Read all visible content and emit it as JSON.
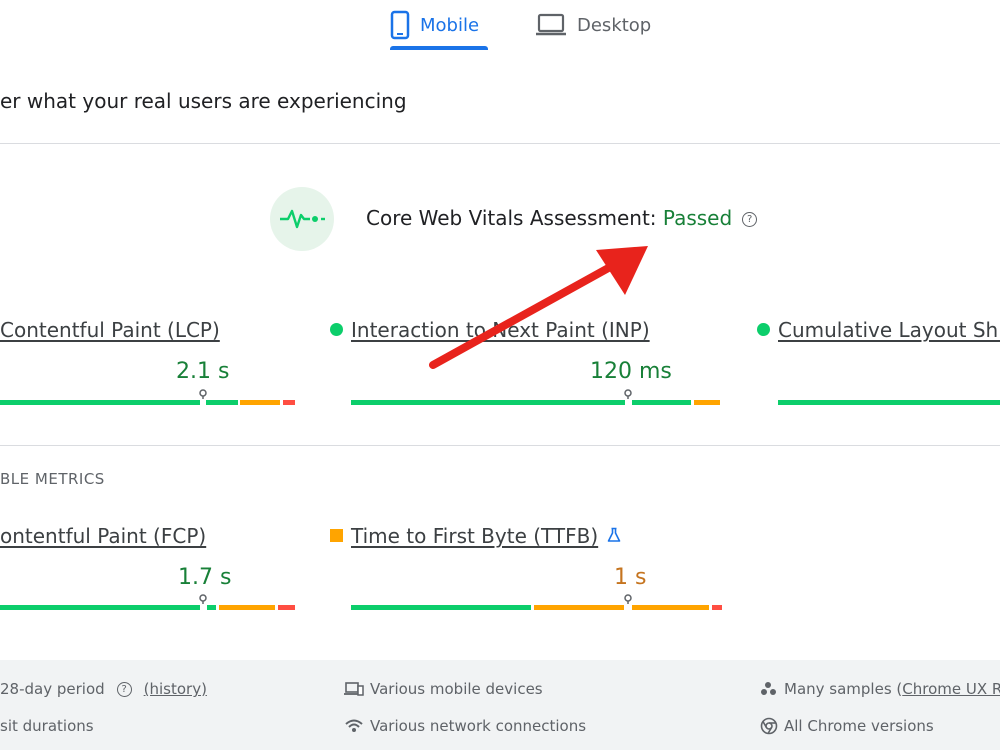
{
  "tabs": [
    {
      "label": "Mobile",
      "icon": "mobile-icon",
      "selected": true
    },
    {
      "label": "Desktop",
      "icon": "desktop-icon",
      "selected": false
    }
  ],
  "subtitle": "er what your real users are experiencing",
  "assessment": {
    "label": "Core Web Vitals Assessment: ",
    "status": "Passed",
    "help": "?"
  },
  "core_metrics": [
    {
      "label": " Contentful Paint (LCP)",
      "value": "2.1 s",
      "rating": "good"
    },
    {
      "label": "Interaction to Next Paint (INP)",
      "value": "120 ms",
      "rating": "good"
    },
    {
      "label": "Cumulative Layout Shif",
      "value": "",
      "rating": "good"
    }
  ],
  "other_section_title": "BLE METRICS",
  "other_metrics": [
    {
      "label": "ontentful Paint (FCP)",
      "value": "1.7 s",
      "rating": "good"
    },
    {
      "label": "Time to First Byte (TTFB)",
      "value": "1 s",
      "rating": "needs-improvement",
      "badge_icon": "flask-icon"
    }
  ],
  "footer": {
    "period_text": " 28-day period",
    "help": "?",
    "history_link": "(history)",
    "durations_text": "sit durations",
    "devices_text": "Various mobile devices",
    "network_text": "Various network connections",
    "samples_text": "Many samples (",
    "samples_link": "Chrome UX R",
    "versions_text": "All Chrome versions"
  },
  "colors": {
    "accent": "#1a73e8",
    "good": "#0cce6b",
    "good_text": "#188038",
    "needs_improvement": "#ffa400",
    "poor": "#ff4e42",
    "annotation_arrow": "#e8231c"
  }
}
